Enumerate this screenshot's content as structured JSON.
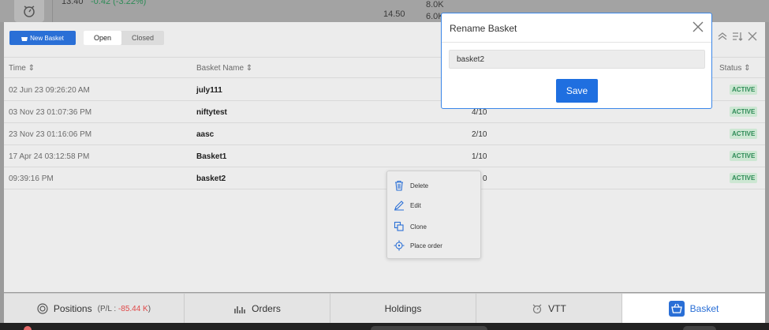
{
  "background": {
    "ticker_prefix": "13.40",
    "ticker_change": "-0.42 (-3.22%)",
    "price": "14.50",
    "vol1": "8.0K",
    "vol2": "6.0K"
  },
  "toolbar": {
    "new_basket_label": "New Basket",
    "tabs": [
      {
        "label": "Open",
        "active": true
      },
      {
        "label": "Closed",
        "active": false
      }
    ]
  },
  "table": {
    "headers": {
      "time": "Time",
      "name": "Basket Name",
      "status": "Status"
    },
    "rows": [
      {
        "time": "02 Jun 23 09:26:20 AM",
        "name": "july111",
        "count": "",
        "status": "ACTIVE"
      },
      {
        "time": "03 Nov 23 01:07:36 PM",
        "name": "niftytest",
        "count": "4/10",
        "status": "ACTIVE"
      },
      {
        "time": "23 Nov 23 01:16:06 PM",
        "name": "aasc",
        "count": "2/10",
        "status": "ACTIVE"
      },
      {
        "time": "17 Apr 24 03:12:58 PM",
        "name": "Basket1",
        "count": "1/10",
        "status": "ACTIVE"
      },
      {
        "time": "09:39:16 PM",
        "name": "basket2",
        "count": "0",
        "status": "ACTIVE"
      }
    ]
  },
  "context_menu": {
    "items": [
      {
        "label": "Delete",
        "icon": "trash-icon"
      },
      {
        "label": "Edit",
        "icon": "edit-icon"
      },
      {
        "label": "Clone",
        "icon": "clone-icon"
      },
      {
        "label": "Place order",
        "icon": "target-icon"
      }
    ]
  },
  "modal": {
    "title": "Rename Basket",
    "input_value": "basket2",
    "save_label": "Save"
  },
  "bottom_tabs": {
    "positions": {
      "label": "Positions",
      "pl_prefix": "(P/L : ",
      "pl_value": "-85.44 K",
      "pl_suffix": ")"
    },
    "orders": {
      "label": "Orders"
    },
    "holdings": {
      "label": "Holdings"
    },
    "vtt": {
      "label": "VTT"
    },
    "basket": {
      "label": "Basket"
    }
  },
  "colors": {
    "accent": "#2a6fd6",
    "active_badge_text": "#2e8b57",
    "active_badge_bg": "#cde7d3",
    "negative": "#e04848"
  }
}
